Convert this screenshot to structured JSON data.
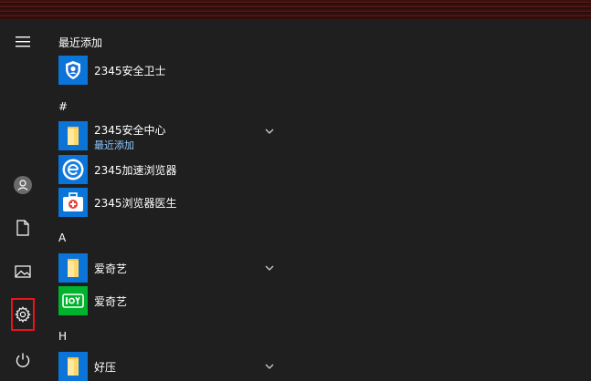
{
  "rail": {
    "items": [
      {
        "icon": "hamburger-menu-icon"
      },
      {
        "icon": "user-avatar-icon"
      },
      {
        "icon": "documents-icon"
      },
      {
        "icon": "pictures-icon"
      },
      {
        "icon": "settings-gear-icon",
        "highlighted": true
      },
      {
        "icon": "power-icon"
      }
    ]
  },
  "groups": {
    "recent": {
      "header": "最近添加",
      "apps": [
        {
          "name": "2345安全卫士",
          "icon": "shield-icon"
        }
      ]
    },
    "hash": {
      "header": "#",
      "apps": [
        {
          "name": "2345安全中心",
          "sub": "最近添加",
          "icon": "folder-icon",
          "expandable": true
        },
        {
          "name": "2345加速浏览器",
          "icon": "browser-icon"
        },
        {
          "name": "2345浏览器医生",
          "icon": "medical-kit-icon"
        }
      ]
    },
    "a": {
      "header": "A",
      "apps": [
        {
          "name": "爱奇艺",
          "icon": "folder-icon",
          "expandable": true
        },
        {
          "name": "爱奇艺",
          "icon": "iqiyi-icon"
        }
      ]
    },
    "h": {
      "header": "H",
      "apps": [
        {
          "name": "好压",
          "icon": "folder-icon",
          "expandable": true
        }
      ]
    }
  },
  "colors": {
    "background": "#1f1f1f",
    "tile_blue": "#0a74d9",
    "tile_green": "#00b32c",
    "sub_text": "#8ec8ff",
    "highlight_border": "#e8141b"
  }
}
